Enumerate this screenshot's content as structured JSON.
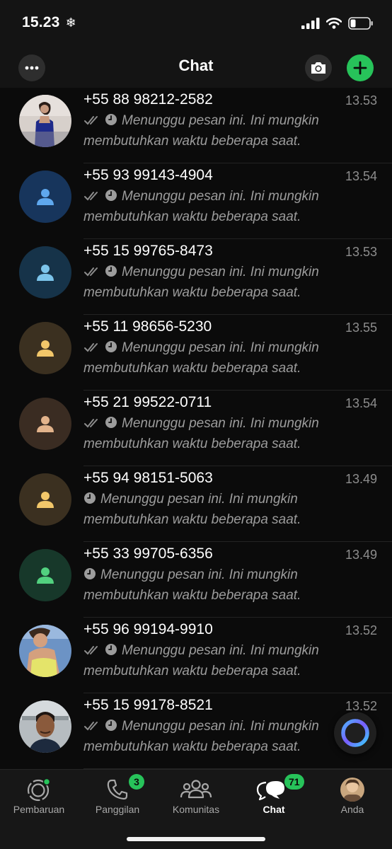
{
  "status": {
    "time": "15.23",
    "time_icon": "snowflake-icon"
  },
  "header": {
    "title": "Chat"
  },
  "chats": [
    {
      "name": "+55 88 98212-2582",
      "time": "13.53",
      "line1": "Menunggu pesan ini. Ini mungkin",
      "line2": "membutuhkan waktu beberapa saat.",
      "ticks": true,
      "avatar": "photo",
      "avatar_theme": "woman-blue-dress"
    },
    {
      "name": "+55 93 99143-4904",
      "time": "13.54",
      "line1": "Menunggu pesan ini. Ini mungkin",
      "line2": "membutuhkan waktu beberapa saat.",
      "ticks": true,
      "avatar": "placeholder",
      "bg": "#17355c",
      "fg": "#5fa8ee"
    },
    {
      "name": "+55 15 99765-8473",
      "time": "13.53",
      "line1": "Menunggu pesan ini. Ini mungkin",
      "line2": "membutuhkan waktu beberapa saat.",
      "ticks": true,
      "avatar": "placeholder",
      "bg": "#163349",
      "fg": "#7cc4ea"
    },
    {
      "name": "+55 11 98656-5230",
      "time": "13.55",
      "line1": "Menunggu pesan ini. Ini mungkin",
      "line2": "membutuhkan waktu beberapa saat.",
      "ticks": true,
      "avatar": "placeholder",
      "bg": "#3b3020",
      "fg": "#f2c76a"
    },
    {
      "name": "+55 21 99522-0711",
      "time": "13.54",
      "line1": "Menunggu pesan ini. Ini mungkin",
      "line2": "membutuhkan waktu beberapa saat.",
      "ticks": true,
      "avatar": "placeholder",
      "bg": "#3a2c22",
      "fg": "#e2b38b"
    },
    {
      "name": "+55 94 98151-5063",
      "time": "13.49",
      "line1": "Menunggu pesan ini. Ini mungkin",
      "line2": "membutuhkan waktu beberapa saat.",
      "ticks": false,
      "avatar": "placeholder",
      "bg": "#3b3020",
      "fg": "#f2c76a"
    },
    {
      "name": "+55 33 99705-6356",
      "time": "13.49",
      "line1": "Menunggu pesan ini. Ini mungkin",
      "line2": "membutuhkan waktu beberapa saat.",
      "ticks": false,
      "avatar": "placeholder",
      "bg": "#17382a",
      "fg": "#52d17f"
    },
    {
      "name": "+55 96 99194-9910",
      "time": "13.52",
      "line1": "Menunggu pesan ini. Ini mungkin",
      "line2": "membutuhkan waktu beberapa saat.",
      "ticks": true,
      "avatar": "photo",
      "avatar_theme": "woman-yellow-top"
    },
    {
      "name": "+55 15 99178-8521",
      "time": "13.52",
      "line1": "Menunggu pesan ini. Ini mungkin",
      "line2": "membutuhkan waktu beberapa saat.",
      "ticks": true,
      "avatar": "photo",
      "avatar_theme": "man-gym"
    }
  ],
  "tabs": [
    {
      "label": "Pembaruan",
      "icon": "status-icon",
      "active": false,
      "badge": ""
    },
    {
      "label": "Panggilan",
      "icon": "phone-icon",
      "active": false,
      "badge": "3"
    },
    {
      "label": "Komunitas",
      "icon": "community-icon",
      "active": false,
      "badge": ""
    },
    {
      "label": "Chat",
      "icon": "chat-icon",
      "active": true,
      "badge": "71"
    },
    {
      "label": "Anda",
      "icon": "profile-avatar",
      "active": false,
      "badge": ""
    }
  ],
  "colors": {
    "accent": "#27c35a",
    "background": "#0b0b0b",
    "bar": "#141414"
  }
}
